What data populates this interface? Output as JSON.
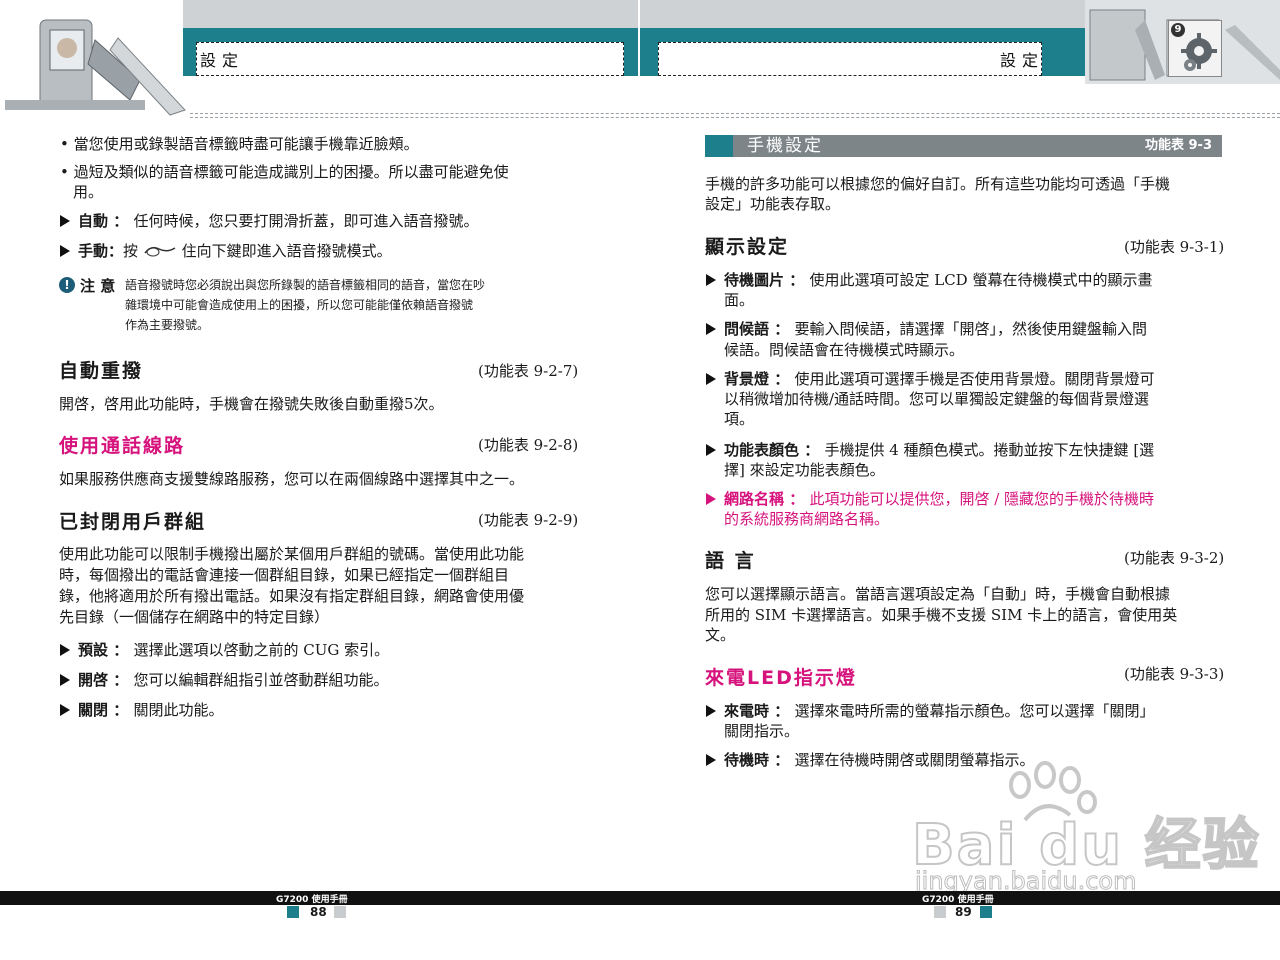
{
  "header": {
    "left_title": "設定",
    "right_title": "設定",
    "icon_badge": "9"
  },
  "left": {
    "bullets": [
      "當您使用或錄製語音標籤時盡可能讓手機靠近臉頰。",
      "過短及類似的語音標籤可能造成識別上的困擾。所以盡可能避免使",
      "用。"
    ],
    "auto_label": "自動",
    "auto_text": "任何時候，您只要打開滑折蓋，即可進入語音撥號。",
    "manual_label": "手動",
    "manual_text_pre": "按",
    "manual_text_post": "住向下鍵即進入語音撥號模式。",
    "note_label": "注 意",
    "note_lines": [
      "語音撥號時您必須說出與您所錄製的語音標籤相同的語音，當您在吵",
      "雜環境中可能會造成使用上的困擾，所以您可能能僅依賴語音撥號",
      "作為主要撥號。"
    ],
    "sec1_title": "自動重撥",
    "sec1_ref": "(功能表 9-2-7)",
    "sec1_text": "開啓，啓用此功能時，手機會在撥號失敗後自動重撥5次。",
    "sec2_title": "使用通話線路",
    "sec2_ref": "(功能表 9-2-8)",
    "sec2_text": "如果服務供應商支援雙線路服務，您可以在兩個線路中選擇其中之一。",
    "sec3_title": "已封閉用戶群組",
    "sec3_ref": "(功能表 9-2-9)",
    "sec3_lines": [
      "使用此功能可以限制手機撥出屬於某個用戶群組的號碼。當使用此功能",
      "時，每個撥出的電話會連接一個群組目錄，如果已經指定一個群組目",
      "錄，他將適用於所有撥出電話。如果沒有指定群組目錄，網路會使用優",
      "先目錄（一個儲存在網路中的特定目錄）"
    ],
    "opt1_label": "預設",
    "opt1_text": "選擇此選項以啓動之前的 CUG 索引。",
    "opt2_label": "開啓",
    "opt2_text": "您可以編輯群組指引並啓動群組功能。",
    "opt3_label": "關閉",
    "opt3_text": "關閉此功能。"
  },
  "right": {
    "banner_title": "手機設定",
    "banner_ref": "功能表 9-3",
    "intro_lines": [
      "手機的許多功能可以根據您的偏好自訂。所有這些功能均可透過「手機",
      "設定」功能表存取。"
    ],
    "sec1_title": "顯示設定",
    "sec1_ref": "(功能表 9-3-1)",
    "items": [
      {
        "label": "待機圖片",
        "lines": [
          "使用此選項可設定 LCD 螢幕在待機模式中的顯示畫",
          "面。"
        ]
      },
      {
        "label": "問候語",
        "lines": [
          "要輸入問候語，請選擇「開啓」，然後使用鍵盤輸入問",
          "候語。問候語會在待機模式時顯示。"
        ]
      },
      {
        "label": "背景燈",
        "lines": [
          "使用此選項可選擇手機是否使用背景燈。關閉背景燈可",
          "以稍微增加待機/通話時間。您可以單獨設定鍵盤的每個背景燈選",
          "項。"
        ]
      },
      {
        "label": "功能表顏色",
        "lines": [
          "手機提供 4 種顏色模式。捲動並按下左快捷鍵 [選",
          "擇] 來設定功能表顏色。"
        ]
      },
      {
        "label": "網路名稱",
        "lines": [
          "此項功能可以提供您，開啓 / 隱藏您的手機於待機時",
          "的系統服務商網路名稱。"
        ]
      }
    ],
    "sec2_title": "語 言",
    "sec2_ref": "(功能表 9-3-2)",
    "sec2_lines": [
      "您可以選擇顯示語言。當語言選項設定為「自動」時，手機會自動根據",
      "所用的 SIM 卡選擇語言。如果手機不支援 SIM 卡上的語言，會使用英",
      "文。"
    ],
    "sec3_title": "來電LED指示燈",
    "sec3_ref": "(功能表 9-3-3)",
    "opt1_label": "來電時",
    "opt1_lines": [
      "選擇來電時所需的螢幕指示顏色。您可以選擇「關閉」",
      "關閉指示。"
    ],
    "opt2_label": "待機時",
    "opt2_text": "選擇在待機時開啓或關閉螢幕指示。"
  },
  "footer": {
    "left_model": "G7200 使用手冊",
    "left_page": "88",
    "right_model": "G7200 使用手冊",
    "right_page": "89"
  },
  "watermark": {
    "brand": "Bai du 经验",
    "url": "jingyan.baidu.com"
  },
  "colors": {
    "teal": "#1e7f8c",
    "pink": "#d6137c",
    "banner": "#7d8589"
  }
}
